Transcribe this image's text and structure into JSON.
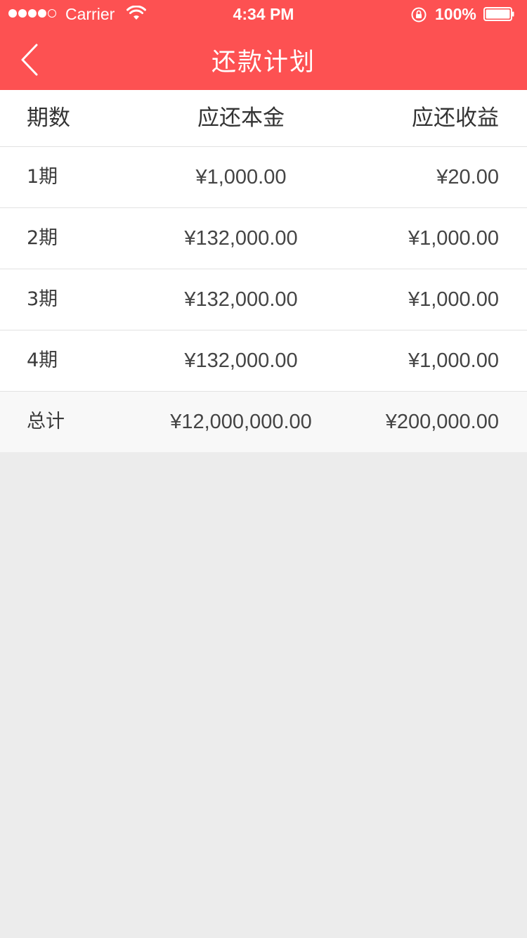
{
  "status_bar": {
    "carrier": "Carrier",
    "time": "4:34 PM",
    "battery_percent": "100%",
    "signal_dots_filled": 4,
    "signal_dots_total": 5
  },
  "nav": {
    "title": "还款计划",
    "back_icon": "chevron-left-icon"
  },
  "table": {
    "columns": [
      "期数",
      "应还本金",
      "应还收益"
    ],
    "rows": [
      {
        "period": "1期",
        "principal": "¥1,000.00",
        "income": "¥20.00"
      },
      {
        "period": "2期",
        "principal": "¥132,000.00",
        "income": "¥1,000.00"
      },
      {
        "period": "3期",
        "principal": "¥132,000.00",
        "income": "¥1,000.00"
      },
      {
        "period": "4期",
        "principal": "¥132,000.00",
        "income": "¥1,000.00"
      }
    ],
    "total": {
      "label": "总计",
      "principal": "¥12,000,000.00",
      "income": "¥200,000.00"
    }
  },
  "colors": {
    "header_bg": "#fd5152",
    "page_bg": "#ececec",
    "total_bg": "#f8f8f8"
  }
}
